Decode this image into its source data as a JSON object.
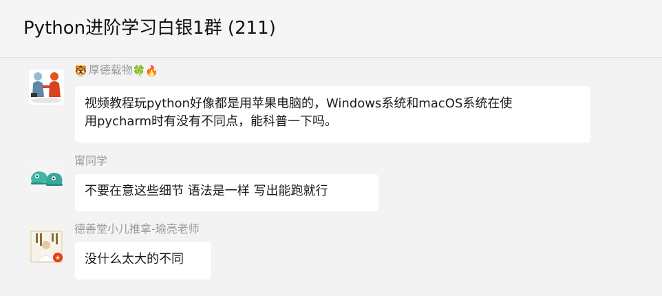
{
  "header": {
    "title": "Python进阶学习白银1群 (211)"
  },
  "messages": [
    {
      "sender": "厚德载物",
      "sender_prefix_icon": "tiger-face",
      "sender_suffix_icons": [
        "clover",
        "fire"
      ],
      "text_line1": "视频教程玩python好像都是用苹果电脑的，Windows系统和macOS系统在使",
      "text_line2": "用pycharm时有没有不同点，能科普一下吗。"
    },
    {
      "sender": "甯同学",
      "text": "不要在意这些细节 语法是一样 写出能跑就行"
    },
    {
      "sender": "德善堂小儿推拿-瑜亮老师",
      "text": "没什么太大的不同"
    }
  ]
}
